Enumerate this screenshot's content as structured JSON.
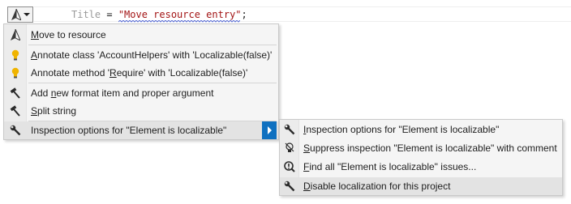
{
  "editor": {
    "code_prop": "Title",
    "code_eq": " = ",
    "code_string": "\"Move resource entry\"",
    "code_end": ";"
  },
  "colors": {
    "menu_bg": "#f5f5f5",
    "highlight": "#e3e3e3",
    "submenu_arrow": "#0e70c0",
    "string": "#a31515",
    "bulb": "#f0b400"
  },
  "main_menu": {
    "items": [
      {
        "pre": "",
        "key": "M",
        "post": "ove to resource",
        "icon": "resharper-triangle-icon"
      },
      {
        "pre": "",
        "key": "A",
        "post": "nnotate class 'AccountHelpers' with 'Localizable(false)'",
        "icon": "lightbulb-icon"
      },
      {
        "pre": "Annotate method ",
        "key": "R",
        "post": "equire' with 'Localizable(false)'",
        "pre_quote": "'",
        "icon": "lightbulb-icon"
      },
      {
        "pre": "Add ",
        "key": "n",
        "post": "ew format item and proper argument",
        "icon": "hammer-icon"
      },
      {
        "pre": "",
        "key": "S",
        "post": "plit string",
        "icon": "hammer-icon"
      },
      {
        "pre": "Inspection options for \"Element is localizable\"",
        "key": "",
        "post": "",
        "icon": "wrench-icon"
      }
    ]
  },
  "sub_menu": {
    "items": [
      {
        "pre": "",
        "key": "I",
        "post": "nspection options for \"Element is localizable\"",
        "icon": "wrench-icon"
      },
      {
        "pre": "",
        "key": "S",
        "post": "uppress inspection \"Element is localizable\" with comment",
        "icon": "suppress-bulb-icon"
      },
      {
        "pre": "",
        "key": "F",
        "post": "ind all \"Element is localizable\" issues...",
        "icon": "find-issues-icon"
      },
      {
        "pre": "",
        "key": "D",
        "post": "isable localization for this project",
        "icon": "wrench-icon"
      }
    ]
  }
}
